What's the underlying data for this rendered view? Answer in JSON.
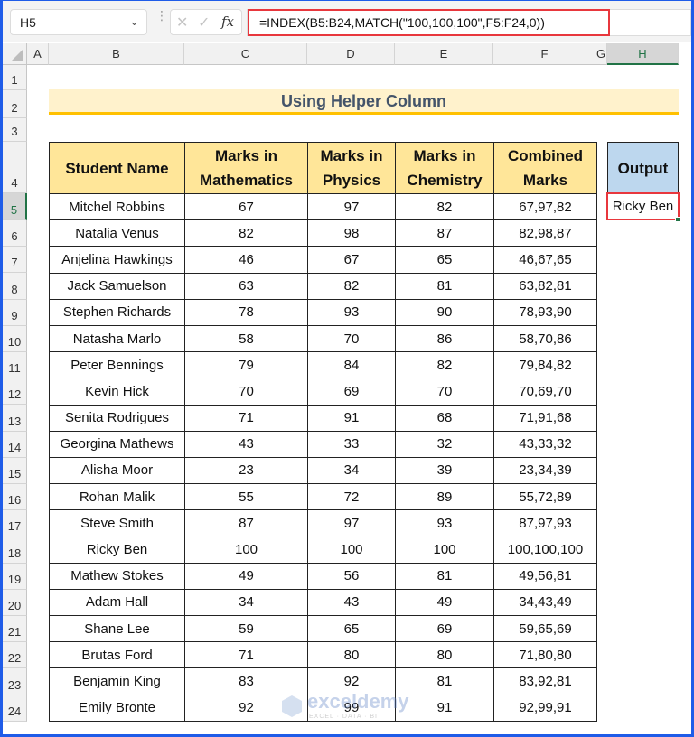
{
  "formula_bar": {
    "name_box": "H5",
    "formula": "=INDEX(B5:B24,MATCH(\"100,100,100\",F5:F24,0))",
    "cancel_icon": "✕",
    "enter_icon": "✓",
    "fx_label": "fx",
    "chevron": "⌄"
  },
  "columns": [
    "A",
    "B",
    "C",
    "D",
    "E",
    "F",
    "G",
    "H"
  ],
  "selected_column": "H",
  "rows": [
    "1",
    "2",
    "3",
    "4",
    "5",
    "6",
    "7",
    "8",
    "9",
    "10",
    "11",
    "12",
    "13",
    "14",
    "15",
    "16",
    "17",
    "18",
    "19",
    "20",
    "21",
    "22",
    "23",
    "24"
  ],
  "selected_row": "5",
  "title": "Using Helper Column",
  "table": {
    "headers": {
      "student": "Student Name",
      "math_1": "Marks in",
      "math_2": "Mathematics",
      "phys_1": "Marks in",
      "phys_2": "Physics",
      "chem_1": "Marks in",
      "chem_2": "Chemistry",
      "comb_1": "Combined",
      "comb_2": "Marks"
    },
    "rows": [
      {
        "name": "Mitchel Robbins",
        "math": "67",
        "phys": "97",
        "chem": "82",
        "comb": "67,97,82"
      },
      {
        "name": "Natalia Venus",
        "math": "82",
        "phys": "98",
        "chem": "87",
        "comb": "82,98,87"
      },
      {
        "name": "Anjelina Hawkings",
        "math": "46",
        "phys": "67",
        "chem": "65",
        "comb": "46,67,65"
      },
      {
        "name": "Jack Samuelson",
        "math": "63",
        "phys": "82",
        "chem": "81",
        "comb": "63,82,81"
      },
      {
        "name": "Stephen Richards",
        "math": "78",
        "phys": "93",
        "chem": "90",
        "comb": "78,93,90"
      },
      {
        "name": "Natasha Marlo",
        "math": "58",
        "phys": "70",
        "chem": "86",
        "comb": "58,70,86"
      },
      {
        "name": "Peter Bennings",
        "math": "79",
        "phys": "84",
        "chem": "82",
        "comb": "79,84,82"
      },
      {
        "name": "Kevin Hick",
        "math": "70",
        "phys": "69",
        "chem": "70",
        "comb": "70,69,70"
      },
      {
        "name": "Senita Rodrigues",
        "math": "71",
        "phys": "91",
        "chem": "68",
        "comb": "71,91,68"
      },
      {
        "name": "Georgina Mathews",
        "math": "43",
        "phys": "33",
        "chem": "32",
        "comb": "43,33,32"
      },
      {
        "name": "Alisha Moor",
        "math": "23",
        "phys": "34",
        "chem": "39",
        "comb": "23,34,39"
      },
      {
        "name": "Rohan Malik",
        "math": "55",
        "phys": "72",
        "chem": "89",
        "comb": "55,72,89"
      },
      {
        "name": "Steve Smith",
        "math": "87",
        "phys": "97",
        "chem": "93",
        "comb": "87,97,93"
      },
      {
        "name": "Ricky Ben",
        "math": "100",
        "phys": "100",
        "chem": "100",
        "comb": "100,100,100"
      },
      {
        "name": "Mathew Stokes",
        "math": "49",
        "phys": "56",
        "chem": "81",
        "comb": "49,56,81"
      },
      {
        "name": "Adam Hall",
        "math": "34",
        "phys": "43",
        "chem": "49",
        "comb": "34,43,49"
      },
      {
        "name": "Shane Lee",
        "math": "59",
        "phys": "65",
        "chem": "69",
        "comb": "59,65,69"
      },
      {
        "name": "Brutas Ford",
        "math": "71",
        "phys": "80",
        "chem": "80",
        "comb": "71,80,80"
      },
      {
        "name": "Benjamin King",
        "math": "83",
        "phys": "92",
        "chem": "81",
        "comb": "83,92,81"
      },
      {
        "name": "Emily Bronte",
        "math": "92",
        "phys": "99",
        "chem": "91",
        "comb": "92,99,91"
      }
    ]
  },
  "output": {
    "header": "Output",
    "value": "Ricky Ben"
  },
  "watermark": {
    "name": "exceldemy",
    "tagline": "EXCEL · DATA · BI"
  },
  "colors": {
    "title_fill": "#fff2cc",
    "title_underline": "#ffc000",
    "header_fill": "#ffe699",
    "output_fill": "#bdd7ee",
    "highlight": "#e8373d",
    "selection": "#217346"
  }
}
